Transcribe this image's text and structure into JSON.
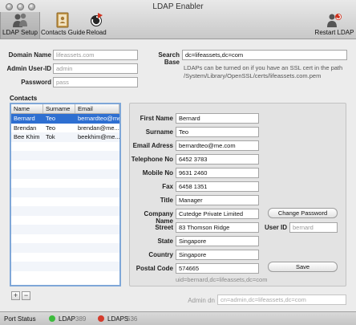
{
  "window": {
    "title": "LDAP Enabler"
  },
  "toolbar": {
    "ldap_setup": "LDAP Setup",
    "contacts_guide": "Contacts Guide",
    "reload": "Reload",
    "restart_ldap": "Restart LDAP"
  },
  "settings": {
    "domain_name_label": "Domain Name",
    "domain_name_value": "lifeassets.com",
    "admin_user_label": "Admin User-ID",
    "admin_user_value": "admin",
    "password_label": "Password",
    "password_value": "pass",
    "search_base_label": "Search Base",
    "search_base_value": "dc=lifeassets,dc=com",
    "ssl_note_line1": "LDAPs can be turned on if you have an SSL cert in the path",
    "ssl_note_line2": "/System/Library/OpenSSL/certs/lifeassets.com.pem"
  },
  "contacts": {
    "title": "Contacts",
    "columns": [
      "Name",
      "Surname",
      "Email"
    ],
    "rows": [
      [
        "Bernard",
        "Teo",
        "bernardteo@me..."
      ],
      [
        "Brendan",
        "Teo",
        "brendan@me..."
      ],
      [
        "Bee Khim",
        "Tok",
        "beekhim@me..."
      ]
    ],
    "add_label": "+",
    "remove_label": "−"
  },
  "detail": {
    "first_name_label": "First Name",
    "first_name": "Bernard",
    "surname_label": "Surname",
    "surname": "Teo",
    "email_label": "Email Adress",
    "email": "bernardteo@me.com",
    "telephone_label": "Telephone No",
    "telephone": "6452 3783",
    "mobile_label": "Mobile No",
    "mobile": "9631 2460",
    "fax_label": "Fax",
    "fax": "6458 1351",
    "title_label": "Title",
    "title": "Manager",
    "company_label": "Company Name",
    "company": "Cutedge Private Limited",
    "street_label": "Street",
    "street": "83 Thomson Ridge",
    "state_label": "State",
    "state": "Singapore",
    "country_label": "Country",
    "country": "Singapore",
    "postal_label": "Postal Code",
    "postal": "574665",
    "change_password_label": "Change Password",
    "user_id_label": "User ID",
    "user_id_placeholder": "bernard",
    "save_label": "Save",
    "dn_text": "uid=bernard,dc=lifeassets,dc=com"
  },
  "admin_dn": {
    "label": "Admin dn",
    "value": "cn=admin,dc=lifeassets,dc=com"
  },
  "status": {
    "port_status_label": "Port Status",
    "ldap_label": "LDAP",
    "ldap_port": "389",
    "ldaps_label": "LDAPS",
    "ldaps_port": "636",
    "ldap_color": "#3dbb3d",
    "ldaps_color": "#d43b2c"
  }
}
